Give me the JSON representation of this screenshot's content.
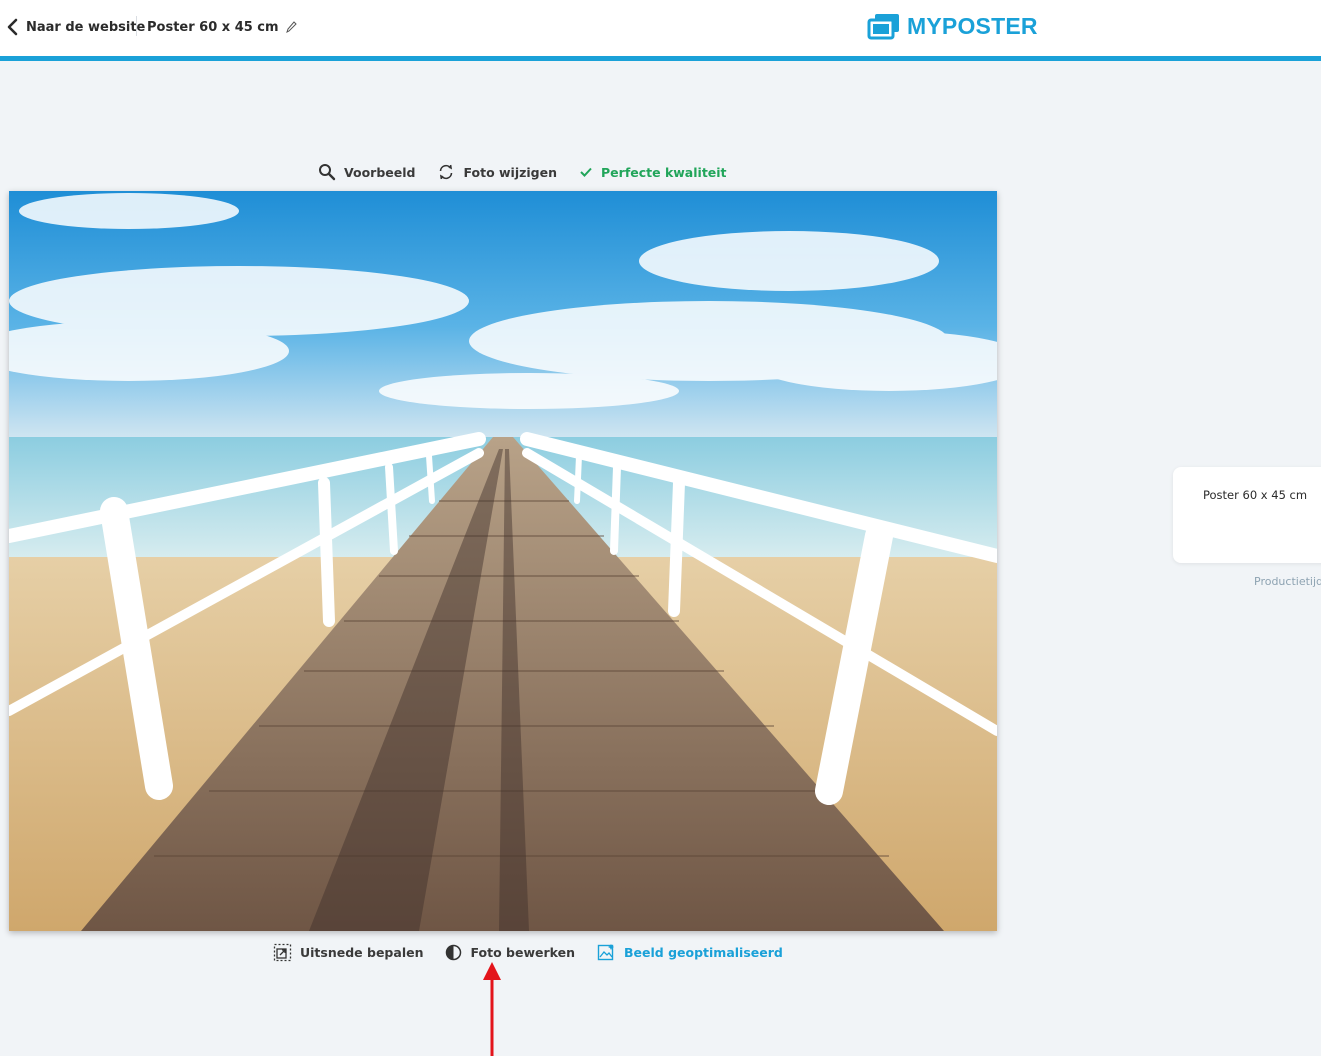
{
  "header": {
    "back_label": "Naar de website",
    "product_name": "Poster 60 x 45 cm",
    "logo_text": "MYPOSTER",
    "accent_color": "#1aa1d8"
  },
  "top_toolbar": {
    "preview_label": "Voorbeeld",
    "change_photo_label": "Foto wijzigen",
    "quality_label": "Perfecte kwaliteit",
    "quality_color": "#21a55a"
  },
  "bottom_toolbar": {
    "crop_label": "Uitsnede bepalen",
    "edit_label": "Foto bewerken",
    "optimized_label": "Beeld geoptimaliseerd"
  },
  "side_panel": {
    "title": "Poster 60 x 45 cm",
    "note": "Productietijd"
  },
  "icons": [
    "chevron-left-icon",
    "pencil-icon",
    "myposter-logo-icon",
    "magnifier-icon",
    "refresh-icon",
    "check-icon",
    "crop-icon",
    "contrast-icon",
    "magic-image-icon",
    "red-arrow-icon"
  ]
}
